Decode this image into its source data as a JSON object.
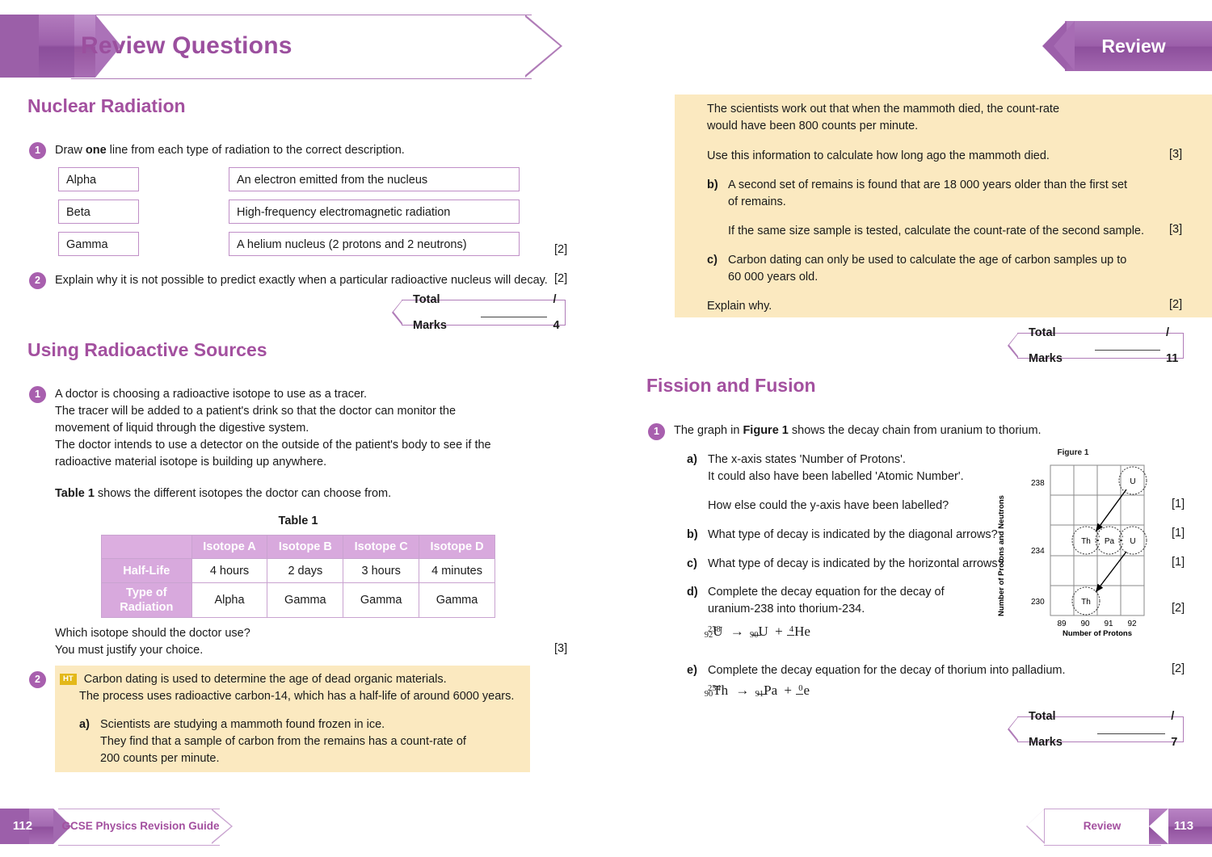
{
  "header": {
    "title": "Review Questions",
    "tab_label": "Review"
  },
  "left_page": {
    "sections": [
      {
        "heading": "Nuclear Radiation",
        "questions": [
          {
            "number": "1",
            "prompt_pre": "Draw ",
            "prompt_bold": "one",
            "prompt_post": " line from each type of radiation to the correct description.",
            "left_boxes": [
              "Alpha",
              "Beta",
              "Gamma"
            ],
            "right_boxes": [
              "An electron emitted from the nucleus",
              "High-frequency electromagnetic radiation",
              "A helium nucleus (2 protons and 2 neutrons)"
            ],
            "marks": "[2]"
          },
          {
            "number": "2",
            "text": "Explain why it is not possible to predict exactly when a particular radioactive nucleus will decay.",
            "marks": "[2]"
          }
        ],
        "total_marks_label": "Total Marks",
        "total_marks_value": "/ 4"
      },
      {
        "heading": "Using Radioactive Sources",
        "q1": {
          "number": "1",
          "lines": [
            "A doctor is choosing a radioactive isotope to use as a tracer.",
            "The tracer will be added to a patient's drink so that the doctor can monitor the",
            "movement of liquid through the digestive system.",
            "The doctor intends to use a detector on the outside of the patient's body to see if the",
            "radioactive material isotope is building up anywhere."
          ],
          "table_intro_bold": "Table 1",
          "table_intro_rest": " shows the different isotopes the doctor can choose from.",
          "table_caption": "Table 1",
          "table": {
            "corner": "",
            "columns": [
              "Isotope A",
              "Isotope B",
              "Isotope C",
              "Isotope D"
            ],
            "rows": [
              {
                "header": "Half-Life",
                "cells": [
                  "4 hours",
                  "2 days",
                  "3 hours",
                  "4 minutes"
                ]
              },
              {
                "header": "Type of Radiation",
                "cells": [
                  "Alpha",
                  "Gamma",
                  "Gamma",
                  "Gamma"
                ]
              }
            ]
          },
          "closing_lines": [
            "Which isotope should the doctor use?",
            "You must justify your choice."
          ],
          "marks": "[3]"
        },
        "q2": {
          "number": "2",
          "ht_badge": "HT",
          "lines": [
            "Carbon dating is used to determine the age of dead organic materials.",
            "The process uses radioactive carbon-14, which has a half-life of around 6000 years."
          ],
          "part_a": {
            "label": "a)",
            "lines": [
              "Scientists are studying a mammoth found frozen in ice.",
              "They find that a sample of carbon from the remains has a count-rate of",
              "200 counts per minute."
            ]
          }
        }
      }
    ],
    "footer": {
      "page_number": "112",
      "title": "GCSE Physics Revision Guide"
    }
  },
  "right_page": {
    "carbon_box": {
      "intro_lines": [
        "The scientists work out that when the mammoth died, the count-rate",
        "would have been 800 counts per minute."
      ],
      "intro_question": "Use this information to calculate how long ago the mammoth died.",
      "intro_marks": "[3]",
      "parts": [
        {
          "label": "b)",
          "lines": [
            "A second set of remains is found that are 18 000 years older than the first set",
            "of remains."
          ],
          "question": "If the same size sample is tested, calculate the count-rate of the second sample.",
          "marks": "[3]"
        },
        {
          "label": "c)",
          "lines": [
            "Carbon dating can only be used to calculate the age of carbon samples up to",
            "60 000 years old."
          ],
          "question": "Explain why.",
          "marks": "[2]"
        }
      ]
    },
    "total_marks_1": {
      "label": "Total Marks",
      "value": "/ 11"
    },
    "fission": {
      "heading": "Fission and Fusion",
      "q1": {
        "number": "1",
        "intro_pre": "The graph in ",
        "intro_bold": "Figure 1",
        "intro_post": " shows the decay chain from uranium to thorium.",
        "parts": [
          {
            "label": "a)",
            "lines": [
              "The x-axis states 'Number of Protons'.",
              "It could also have been labelled 'Atomic Number'."
            ],
            "question": "How else could the y-axis have been labelled?",
            "marks": "[1]"
          },
          {
            "label": "b)",
            "question": "What type of decay is indicated by the diagonal arrows?",
            "marks": "[1]"
          },
          {
            "label": "c)",
            "question": "What type of decay is indicated by the horizontal arrows?",
            "marks": "[1]"
          },
          {
            "label": "d)",
            "lines": [
              "Complete the decay equation for the decay of",
              "uranium-238 into thorium-234."
            ],
            "marks": "[2]"
          },
          {
            "label": "e)",
            "lines": [
              "Complete the decay equation for the decay of thorium into palladium."
            ],
            "marks": "[2]"
          }
        ],
        "equation_d": {
          "lhs_mass": "238",
          "lhs_atomic": "92",
          "lhs_symbol": "U",
          "arrow": "→",
          "p1_mass": "",
          "p1_atomic": "90",
          "p1_symbol": "U",
          "plus": "+",
          "p2_mass": "4",
          "p2_atomic": "",
          "p2_symbol": "He"
        },
        "equation_e": {
          "lhs_mass": "234",
          "lhs_atomic": "90",
          "lhs_symbol": "Th",
          "arrow": "→",
          "p1_mass": "",
          "p1_atomic": "91",
          "p1_symbol": "Pa",
          "plus": "+",
          "p2_mass": "0",
          "p2_atomic": "",
          "p2_symbol": "e"
        }
      }
    },
    "total_marks_2": {
      "label": "Total Marks",
      "value": "/ 7"
    },
    "footer": {
      "label": "Review",
      "page_number": "113"
    }
  },
  "chart_data": {
    "type": "scatter",
    "title": "Figure 1",
    "xlabel": "Number of Protons",
    "ylabel": "Number of Protons and Neutrons",
    "xticks": [
      "89",
      "90",
      "91",
      "92"
    ],
    "yticks": [
      "238",
      "234",
      "230"
    ],
    "xlim": [
      88.5,
      92.5
    ],
    "ylim": [
      228,
      240
    ],
    "grid": true,
    "points": [
      {
        "label": "U",
        "x": 92,
        "y": 238
      },
      {
        "label": "Th",
        "x": 90,
        "y": 234
      },
      {
        "label": "Pa",
        "x": 91,
        "y": 234
      },
      {
        "label": "U",
        "x": 92,
        "y": 234
      },
      {
        "label": "Th",
        "x": 90,
        "y": 230
      }
    ],
    "arrows": [
      {
        "from": [
          92,
          238
        ],
        "to": [
          90,
          234
        ],
        "kind": "diagonal"
      },
      {
        "from": [
          90,
          234
        ],
        "to": [
          91,
          234
        ],
        "kind": "horizontal"
      },
      {
        "from": [
          91,
          234
        ],
        "to": [
          92,
          234
        ],
        "kind": "horizontal"
      },
      {
        "from": [
          92,
          234
        ],
        "to": [
          90,
          230
        ],
        "kind": "diagonal"
      }
    ]
  }
}
